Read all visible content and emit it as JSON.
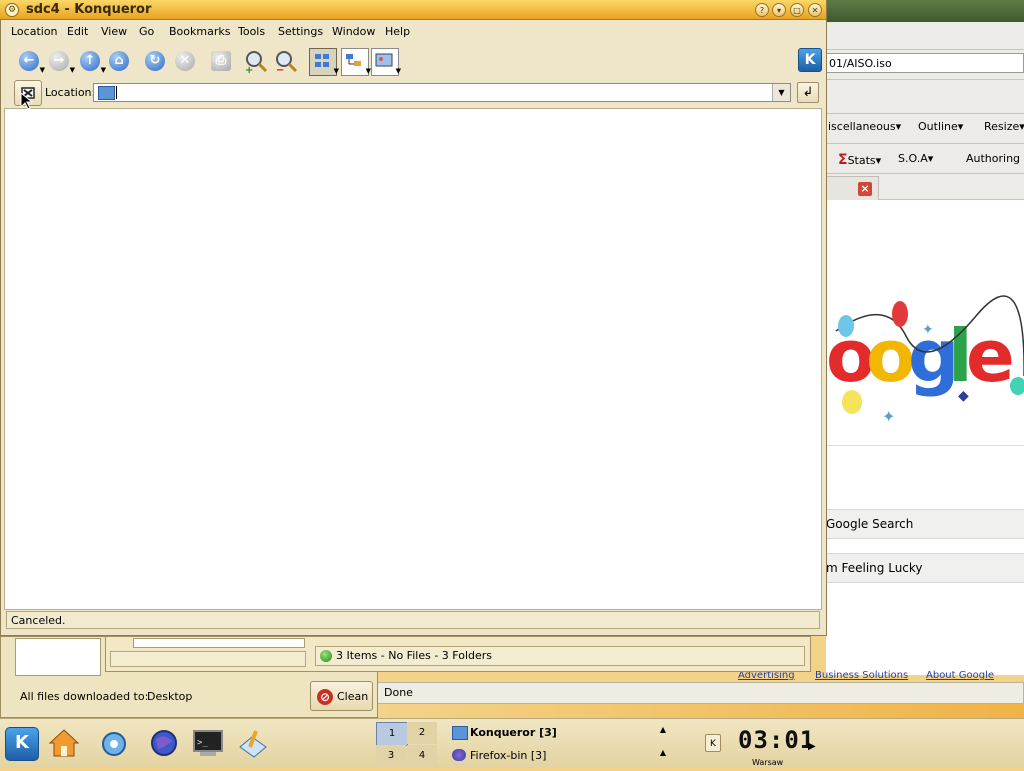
{
  "konqueror": {
    "title": "sdc4 - Konqueror",
    "menu": [
      "Location",
      "Edit",
      "View",
      "Go",
      "Bookmarks",
      "Tools",
      "Settings",
      "Window",
      "Help"
    ],
    "location_label": "Location:",
    "location_value": "",
    "status": "Canceled."
  },
  "firefox": {
    "url_fragment": "01/AISO.iso",
    "toolbar1": [
      "iscellaneous▾",
      "Outline▾",
      "Resize▾"
    ],
    "toolbar2": [
      "Stats▾",
      "S.O.A▾",
      "Authoring"
    ],
    "buttons": [
      "Google Search",
      "m Feeling Lucky"
    ],
    "links": [
      "Advertising",
      "Business Solutions",
      "About Google"
    ],
    "status": "Done"
  },
  "downloads": {
    "label": "All files downloaded to:",
    "folder": "Desktop",
    "clean_label": "Clean"
  },
  "filemanager": {
    "status": "3 Items - No Files - 3 Folders"
  },
  "panel": {
    "pager": [
      "1",
      "2",
      "3",
      "4"
    ],
    "tasks": [
      "Konqueror [3]",
      "Firefox-bin [3]"
    ],
    "clock": "03:01",
    "city": "Warsaw"
  },
  "colors": {
    "titlebar": "#f2bd3c",
    "window_bg": "#efe6c9",
    "panel": "#e9dcae",
    "kde_blue": "#2d6cc4"
  },
  "icons": [
    "back-icon",
    "forward-icon",
    "up-icon",
    "home-icon",
    "reload-icon",
    "stop-icon",
    "print-icon",
    "zoom-in-icon",
    "zoom-out-icon",
    "icon-view-icon",
    "tree-view-icon",
    "preview-icon",
    "kde-logo-icon",
    "clear-location-icon",
    "folder-icon",
    "go-icon"
  ]
}
